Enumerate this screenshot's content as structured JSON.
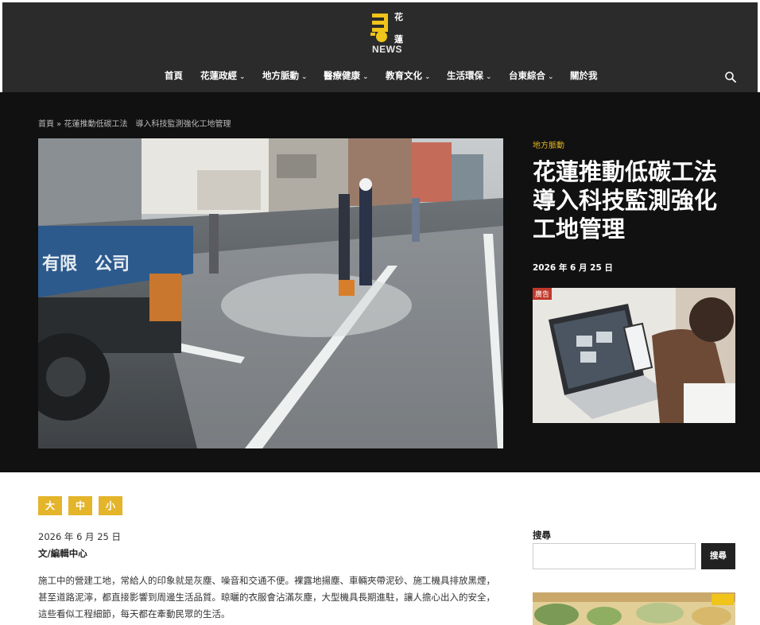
{
  "site": {
    "logo_char_top": "花",
    "logo_char_bottom": "蓮",
    "logo_text": "NEWS",
    "brand_color": "#f0c419"
  },
  "nav": {
    "items": [
      {
        "label": "首頁",
        "has_dropdown": false
      },
      {
        "label": "花蓮政經",
        "has_dropdown": true
      },
      {
        "label": "地方脈動",
        "has_dropdown": true
      },
      {
        "label": "醫療健康",
        "has_dropdown": true
      },
      {
        "label": "教育文化",
        "has_dropdown": true
      },
      {
        "label": "生活環保",
        "has_dropdown": true
      },
      {
        "label": "台東綜合",
        "has_dropdown": true
      },
      {
        "label": "關於我",
        "has_dropdown": false
      }
    ],
    "search_icon": "search-icon"
  },
  "breadcrumb": {
    "home": "首頁",
    "sep": " » ",
    "current": "花蓮推動低碳工法　導入科技監測強化工地管理"
  },
  "hero": {
    "category": "地方脈動",
    "title": "花蓮推動低碳工法導入科技監測強化工地管理",
    "date": "2026 年 6 月 25 日",
    "truck_text": "有限　公司",
    "ad_label": "廣告",
    "accent_color": "#e2b41f"
  },
  "article": {
    "font_sizes": [
      "大",
      "中",
      "小"
    ],
    "date": "2026 年 6 月 25 日",
    "author": "文/編輯中心",
    "body": "施工中的營建工地，常給人的印象就是灰塵、噪音和交通不便。裸露地揚塵、車輛夾帶泥砂、施工機具排放黑煙，甚至道路泥濘，都直接影響到周邊生活品質。晾曬的衣服會沾滿灰塵，大型機具長期進駐，讓人擔心出入的安全，這些看似工程細節，每天都在牽動民眾的生活。"
  },
  "sidebar": {
    "search_title": "搜尋",
    "search_button": "搜尋",
    "search_placeholder": ""
  }
}
